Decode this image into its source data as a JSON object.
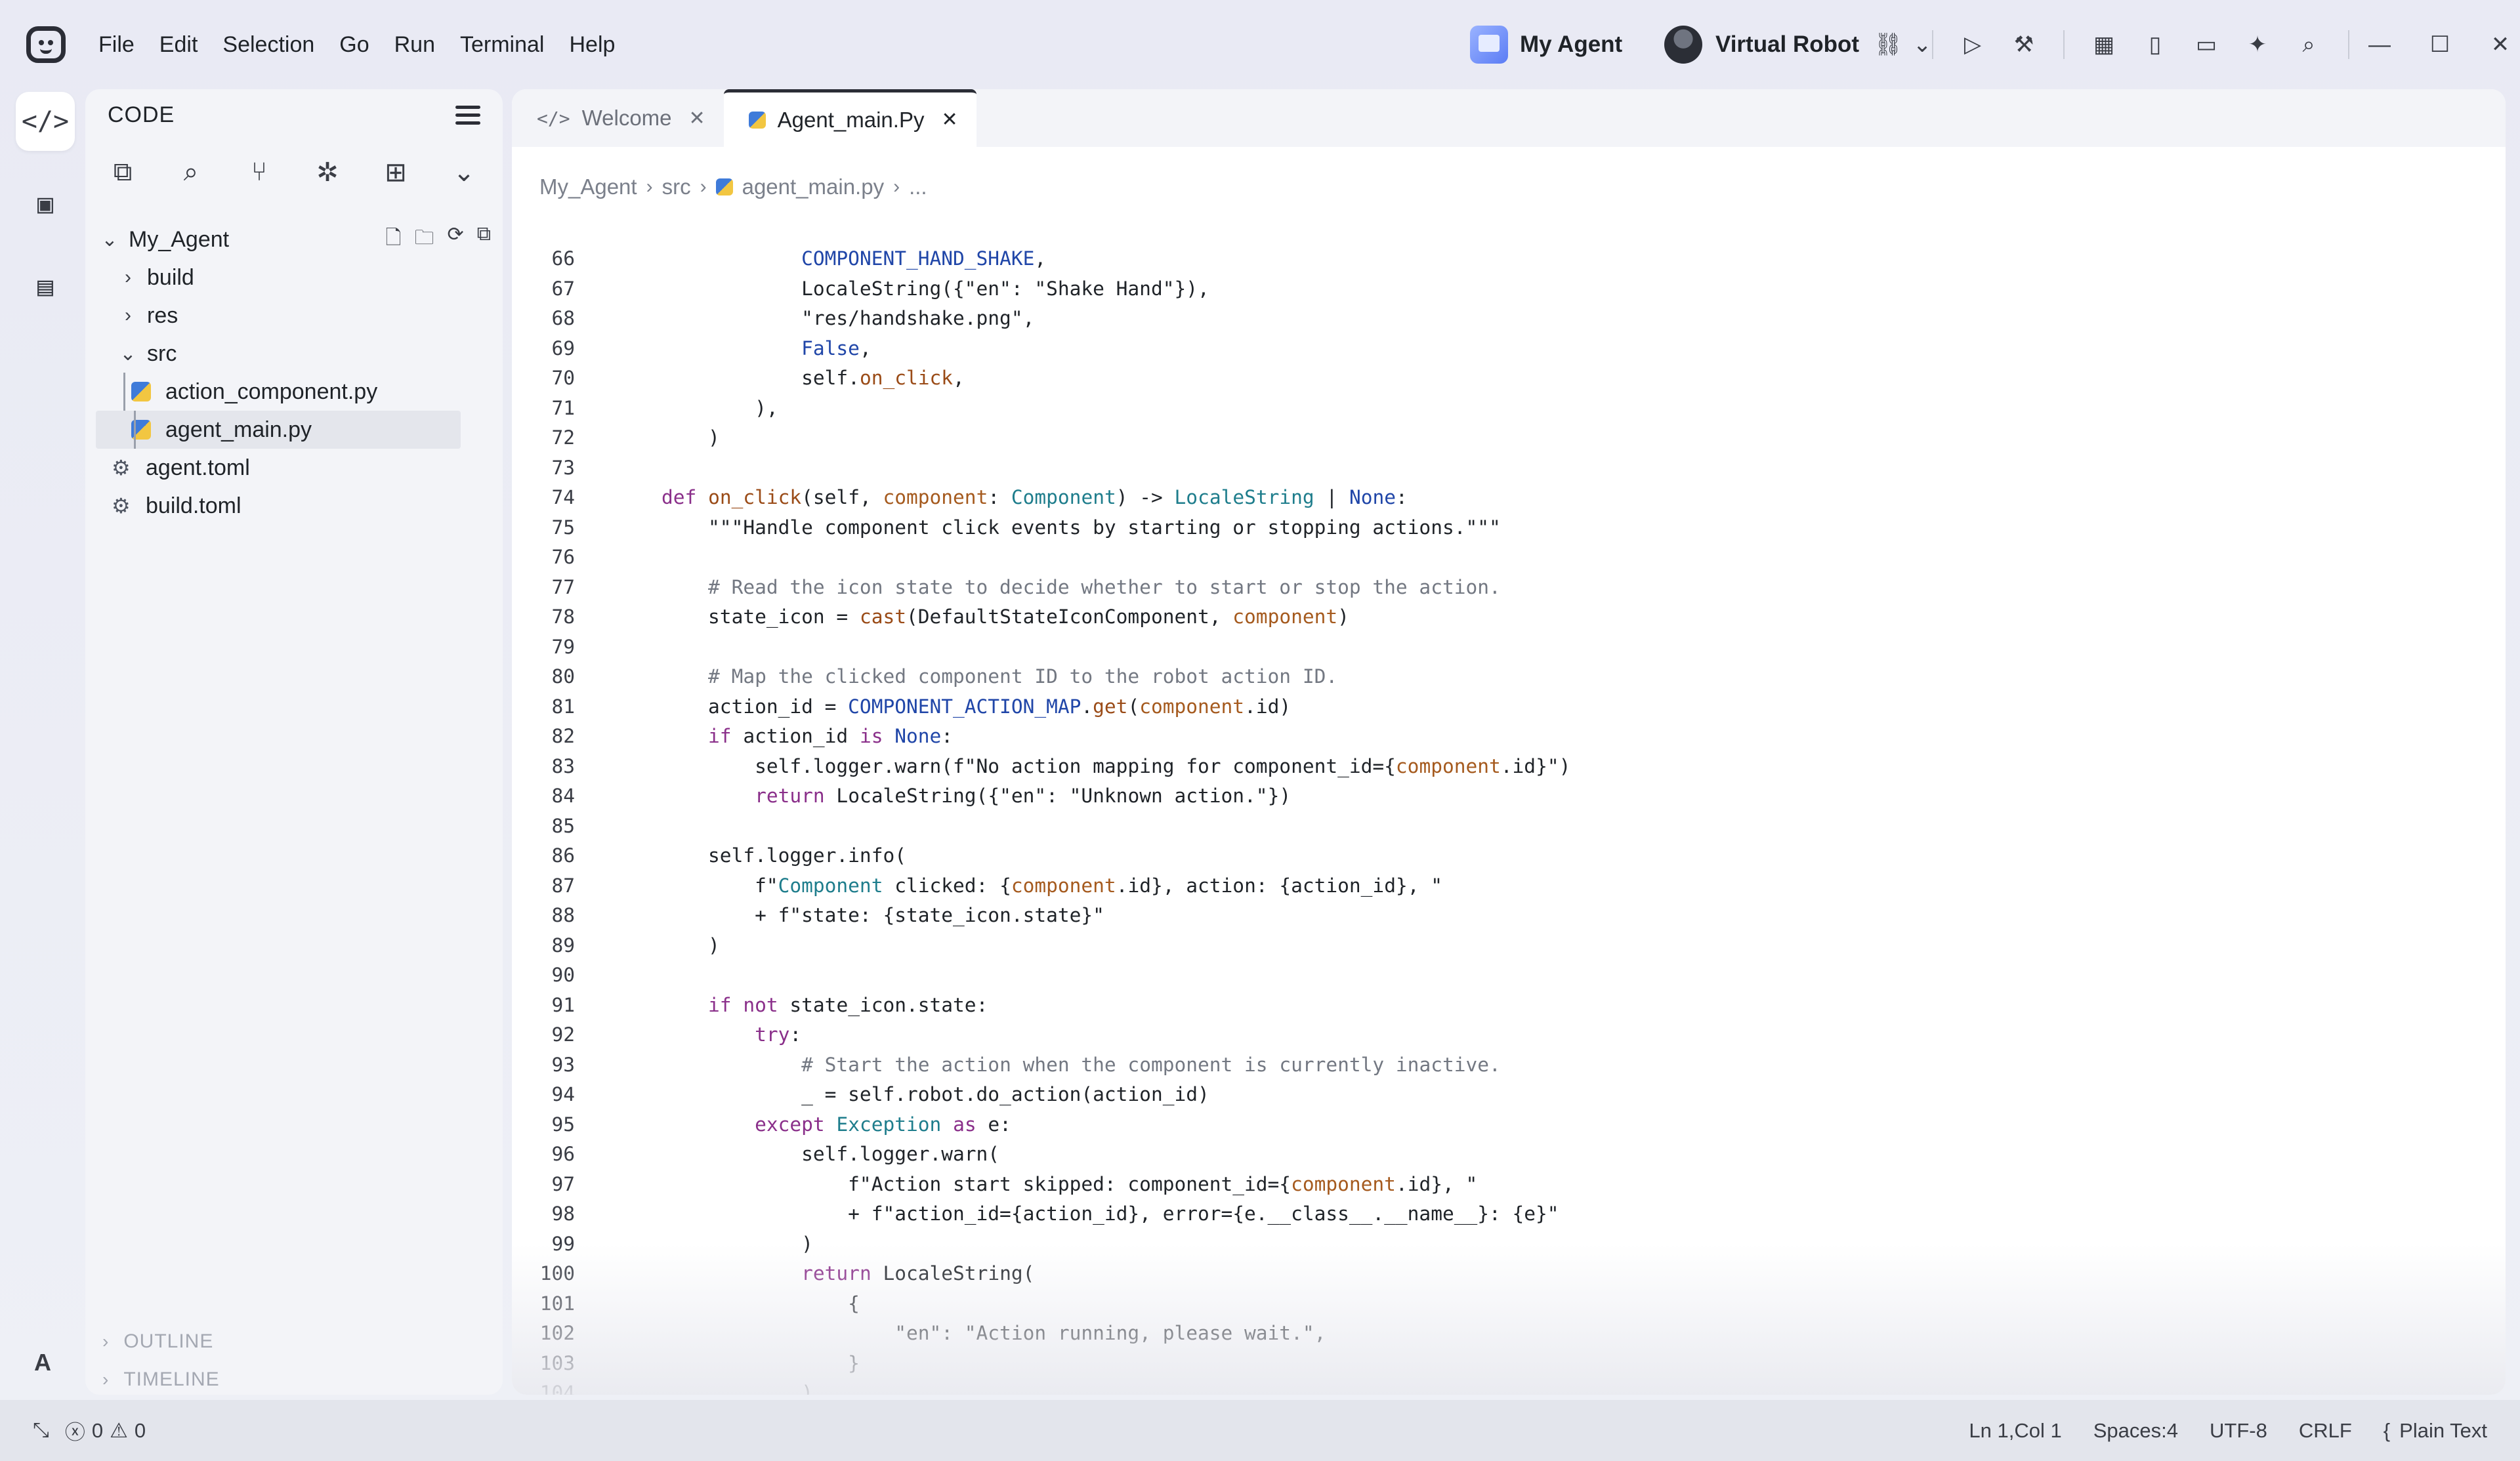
{
  "menu": [
    "File",
    "Edit",
    "Selection",
    "Go",
    "Run",
    "Terminal",
    "Help"
  ],
  "titlebar": {
    "agent_label": "My Agent",
    "robot_label": "Virtual Robot"
  },
  "sidebar": {
    "title": "CODE",
    "root": "My_Agent",
    "items": [
      {
        "label": "build",
        "kind": "folder"
      },
      {
        "label": "res",
        "kind": "folder"
      },
      {
        "label": "src",
        "kind": "folder-open"
      },
      {
        "label": "action_component.py",
        "kind": "python"
      },
      {
        "label": "agent_main.py",
        "kind": "python"
      },
      {
        "label": "agent.toml",
        "kind": "config"
      },
      {
        "label": "build.toml",
        "kind": "config"
      }
    ],
    "outline": "OUTLINE",
    "timeline": "TIMELINE",
    "account": "A"
  },
  "tabs": [
    {
      "label": "Welcome",
      "icon": "code-icon"
    },
    {
      "label": "Agent_main.Py",
      "icon": "python-icon"
    }
  ],
  "breadcrumb": [
    "My_Agent",
    "src",
    "agent_main.py",
    "..."
  ],
  "code": {
    "lines": [
      {
        "n": "66",
        "t": "            COMPONENT_HAND_SHAKE,"
      },
      {
        "n": "67",
        "t": "            LocaleString({\"en\": \"Shake Hand\"}),"
      },
      {
        "n": "68",
        "t": "            \"res/handshake.png\","
      },
      {
        "n": "69",
        "t": "            False,"
      },
      {
        "n": "70",
        "t": "            self.on_click,"
      },
      {
        "n": "71",
        "t": "        ),"
      },
      {
        "n": "72",
        "t": "    )"
      },
      {
        "n": "73",
        "t": ""
      },
      {
        "n": "74",
        "t": "def on_click(self, component: Component) -> LocaleString | None:"
      },
      {
        "n": "75",
        "t": "    \"\"\"Handle component click events by starting or stopping actions.\"\"\""
      },
      {
        "n": "76",
        "t": ""
      },
      {
        "n": "77",
        "t": "    # Read the icon state to decide whether to start or stop the action."
      },
      {
        "n": "78",
        "t": "    state_icon = cast(DefaultStateIconComponent, component)"
      },
      {
        "n": "79",
        "t": ""
      },
      {
        "n": "80",
        "t": "    # Map the clicked component ID to the robot action ID."
      },
      {
        "n": "81",
        "t": "    action_id = COMPONENT_ACTION_MAP.get(component.id)"
      },
      {
        "n": "82",
        "t": "    if action_id is None:"
      },
      {
        "n": "83",
        "t": "        self.logger.warn(f\"No action mapping for component_id={component.id}\")"
      },
      {
        "n": "84",
        "t": "        return LocaleString({\"en\": \"Unknown action.\"})"
      },
      {
        "n": "85",
        "t": ""
      },
      {
        "n": "86",
        "t": "    self.logger.info("
      },
      {
        "n": "87",
        "t": "        f\"Component clicked: {component.id}, action: {action_id}, \""
      },
      {
        "n": "88",
        "t": "        + f\"state: {state_icon.state}\""
      },
      {
        "n": "89",
        "t": "    )"
      },
      {
        "n": "90",
        "t": ""
      },
      {
        "n": "91",
        "t": "    if not state_icon.state:"
      },
      {
        "n": "92",
        "t": "        try:"
      },
      {
        "n": "93",
        "t": "            # Start the action when the component is currently inactive."
      },
      {
        "n": "94",
        "t": "            _ = self.robot.do_action(action_id)"
      },
      {
        "n": "95",
        "t": "        except Exception as e:"
      },
      {
        "n": "96",
        "t": "            self.logger.warn("
      },
      {
        "n": "97",
        "t": "                f\"Action start skipped: component_id={component.id}, \""
      },
      {
        "n": "98",
        "t": "                + f\"action_id={action_id}, error={e.__class__.__name__}: {e}\""
      },
      {
        "n": "99",
        "t": "            )"
      },
      {
        "n": "100",
        "t": "            return LocaleString("
      },
      {
        "n": "101",
        "t": "                {"
      },
      {
        "n": "102",
        "t": "                    \"en\": \"Action running, please wait.\","
      },
      {
        "n": "103",
        "t": "                }"
      },
      {
        "n": "104",
        "t": "            )"
      }
    ]
  },
  "statusbar": {
    "errors": "0",
    "warnings": "0",
    "position": "Ln 1,Col 1",
    "spaces": "Spaces:4",
    "encoding": "UTF-8",
    "eol": "CRLF",
    "language": "Plain Text"
  },
  "colors": {
    "accent": "#2b2d36",
    "background": "#eef0f6",
    "keyword": "#8a2f8a",
    "type": "#1e7d8c",
    "comment": "#737882"
  }
}
